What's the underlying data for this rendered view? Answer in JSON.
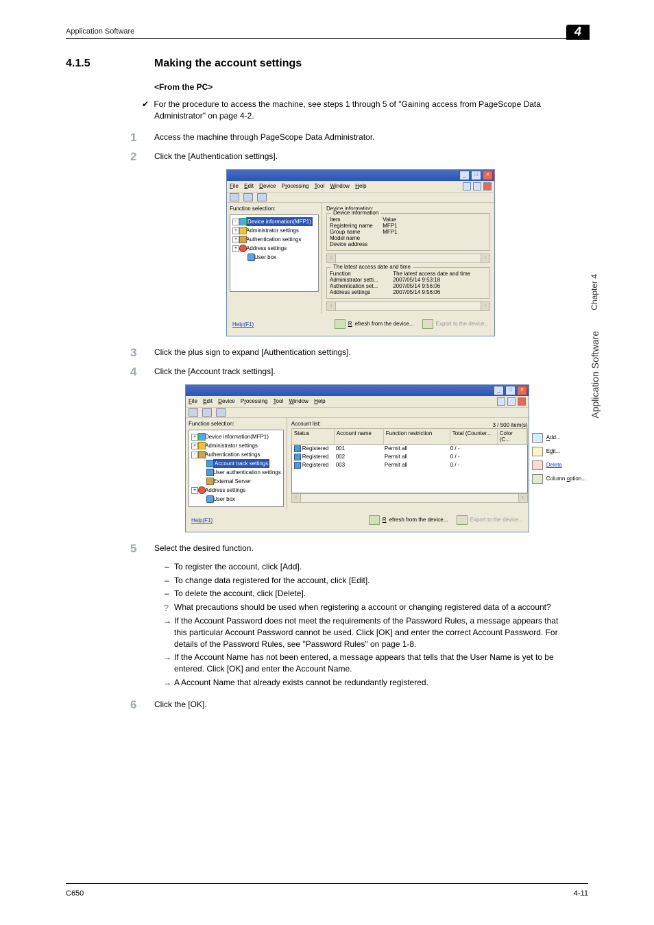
{
  "runningHead": "Application Software",
  "cornerNum": "4",
  "section": {
    "num": "4.1.5",
    "title": "Making the account settings"
  },
  "subhead": "<From the PC>",
  "lead": {
    "check": "✔",
    "text": "For the procedure to access the machine, see steps 1 through 5 of \"Gaining access from PageScope Data Administrator\" on page 4-2."
  },
  "steps": {
    "s1": {
      "n": "1",
      "t": "Access the machine through PageScope Data Administrator."
    },
    "s2": {
      "n": "2",
      "t": "Click the [Authentication settings]."
    },
    "s3": {
      "n": "3",
      "t": "Click the plus sign to expand [Authentication settings]."
    },
    "s4": {
      "n": "4",
      "t": "Click the [Account track settings]."
    },
    "s5": {
      "n": "5",
      "t": "Select the desired function."
    },
    "s6": {
      "n": "6",
      "t": "Click the [OK]."
    }
  },
  "sub5": {
    "b1": "To register the account, click [Add].",
    "b2": "To change data registered for the account, click [Edit].",
    "b3": "To delete the account, click [Delete].",
    "q": "What precautions should be used when registering a account or changing registered data of a account?",
    "a1": "If the Account Password does not meet the requirements of the Password Rules, a message appears that this particular Account Password cannot be used. Click [OK] and enter the correct Account Password. For details of the Password Rules, see \"Password Rules\" on page 1-8.",
    "a2": "If the Account Name has not been entered, a message appears that tells that the User Name is yet to be entered. Click [OK] and enter the Account Name.",
    "a3": "A Account Name that already exists cannot be redundantly registered."
  },
  "menus": {
    "file": "File",
    "edit": "Edit",
    "device": "Device",
    "processing": "Processing",
    "tool": "Tool",
    "window": "Window",
    "help": "Help"
  },
  "win1": {
    "funcSel": "Function selection:",
    "tree": {
      "devInfo": "Device information(MFP1)",
      "admin": "Administrator settings",
      "auth": "Authentication settings",
      "addr": "Address settings",
      "userBox": "User box"
    },
    "right": {
      "header": "Device information:",
      "gb1": "Device information",
      "col1": {
        "item": "Item",
        "reg": "Registering name",
        "grp": "Group name",
        "mdl": "Model name",
        "devaddr": "Device address"
      },
      "col2": {
        "value": "Value",
        "regv": "MFP1",
        "grpv": "MFP1"
      },
      "gb2": "The latest access date and time",
      "t2c1": {
        "func": "Function",
        "adm": "Administrator setti...",
        "auth": "Authentication set...",
        "addr": "Address settings"
      },
      "t2c2": {
        "h": "The latest access date and time",
        "v1": "2007/05/14 9:53:18",
        "v2": "2007/05/14 9:56:06",
        "v3": "2007/05/14 9:56:06"
      }
    },
    "help": "Help(F1)",
    "refresh": "Refresh from the device...",
    "export": "Export to the device..."
  },
  "win2": {
    "funcSel": "Function selection:",
    "tree": {
      "devInfo": "Device information(MFP1)",
      "admin": "Administrator settings",
      "auth": "Authentication settings",
      "acct": "Account track settings",
      "userauth": "User authentication settings",
      "ext": "External Server",
      "addr": "Address settings",
      "userBox": "User box"
    },
    "listLabel": "Account list:",
    "count": "3 / 500 item(s)",
    "cols": {
      "status": "Status",
      "name": "Account name",
      "func": "Function restriction",
      "total": "Total (Counter...",
      "color": "Color (C..."
    },
    "rows": [
      {
        "status": "Registered",
        "name": "001",
        "func": "Permit all",
        "total": "0 / -",
        "color": ""
      },
      {
        "status": "Registered",
        "name": "002",
        "func": "Permit all",
        "total": "0 / -",
        "color": ""
      },
      {
        "status": "Registered",
        "name": "003",
        "func": "Permit all",
        "total": "0 / -",
        "color": ""
      }
    ],
    "btns": {
      "add": "Add...",
      "edit": "Edit...",
      "del": "Delete",
      "col": "Column option..."
    },
    "help": "Help(F1)",
    "refresh": "Refresh from the device...",
    "export": "Export to the device..."
  },
  "side": {
    "chapter": "Chapter 4",
    "section": "Application Software"
  },
  "footer": {
    "left": "C650",
    "right": "4-11"
  }
}
